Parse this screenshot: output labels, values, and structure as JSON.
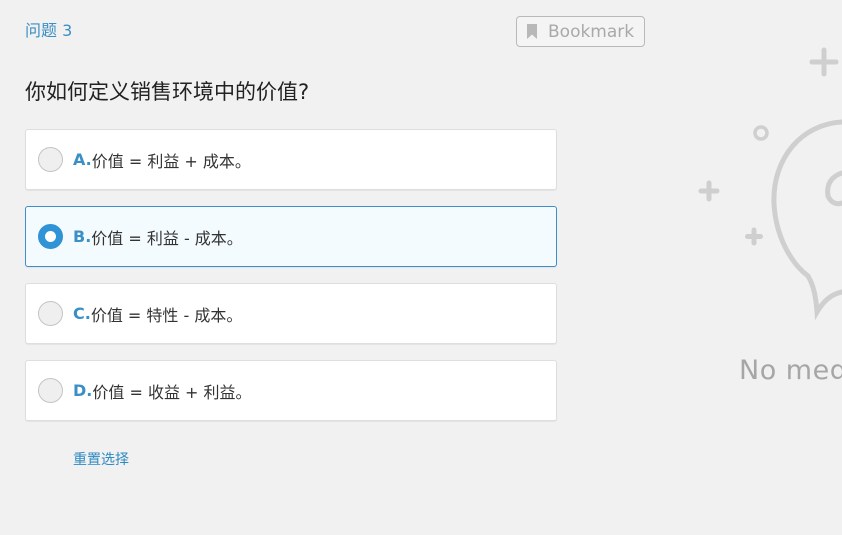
{
  "question": {
    "number_label": "问题 3",
    "text": "你如何定义销售环境中的价值?"
  },
  "bookmark": {
    "label": "Bookmark",
    "icon": "bookmark-icon"
  },
  "options": [
    {
      "letter": "A.",
      "text": "价值 = 利益 + 成本。",
      "selected": false
    },
    {
      "letter": "B.",
      "text": "价值 = 利益 - 成本。",
      "selected": true
    },
    {
      "letter": "C.",
      "text": "价值 = 特性 - 成本。",
      "selected": false
    },
    {
      "letter": "D.",
      "text": "价值 = 收益 + 利益。",
      "selected": false
    }
  ],
  "reset_label": "重置选择",
  "media": {
    "placeholder_text": "No med"
  },
  "colors": {
    "accent": "#3a8fc4",
    "selected_radio": "#2f93d6",
    "selected_bg": "#f4fbfe",
    "background": "#f1f1f1"
  }
}
